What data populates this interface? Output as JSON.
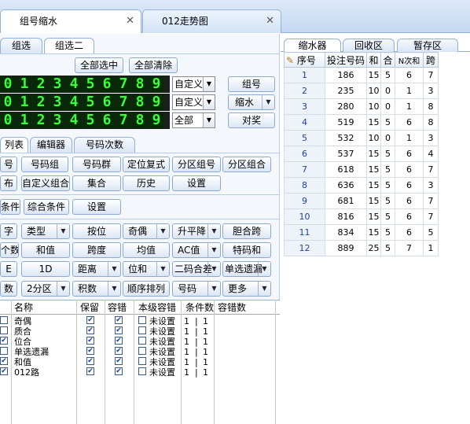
{
  "doc_tabs": [
    {
      "label": "组号缩水",
      "close": "✕"
    },
    {
      "label": "012走势图",
      "close": "✕"
    }
  ],
  "group_tabs": [
    "组选",
    "组选二"
  ],
  "actions": {
    "select_all": "全部选中",
    "clear_all": "全部清除"
  },
  "digit_rows": [
    {
      "digits": [
        "0",
        "1",
        "2",
        "3",
        "4",
        "5",
        "6",
        "7",
        "8",
        "9"
      ],
      "mode": "自定义"
    },
    {
      "digits": [
        "0",
        "1",
        "2",
        "3",
        "4",
        "5",
        "6",
        "7",
        "8",
        "9"
      ],
      "mode": "自定义"
    },
    {
      "digits": [
        "0",
        "1",
        "2",
        "3",
        "4",
        "5",
        "6",
        "7",
        "8",
        "9"
      ],
      "mode": "全部"
    }
  ],
  "side_buttons": {
    "group": "组号",
    "shrink": "缩水",
    "award": "对奖"
  },
  "tool_tabs": [
    "列表",
    "编辑器",
    "号码次数"
  ],
  "row1": [
    "号",
    "号码组",
    "号码群",
    "定位复式",
    "分区组号",
    "分区组合"
  ],
  "row2": [
    "布",
    "自定义组合",
    "集合",
    "历史",
    "设置"
  ],
  "row3": [
    "条件",
    "综合条件",
    "设置"
  ],
  "cond_row1": [
    "字",
    "类型",
    "按位",
    "奇偶",
    "升平降",
    "胆合跨"
  ],
  "cond_row2": [
    "个数",
    "和值",
    "跨度",
    "均值",
    "AC值",
    "特码和"
  ],
  "cond_row3": [
    "E",
    "1D",
    "距离",
    "位和",
    "二码合差",
    "单选遗漏"
  ],
  "cond_row4": [
    "数",
    "2分区",
    "积数",
    "顺序排列",
    "号码",
    "更多"
  ],
  "cond_table": {
    "headers": [
      "名称",
      "保留",
      "容错",
      "本级容错",
      "条件数",
      "容错数"
    ],
    "rows": [
      {
        "name": "奇偶",
        "level": "未设置",
        "cond": "1",
        "tol": "1"
      },
      {
        "name": "质合",
        "level": "未设置",
        "cond": "1",
        "tol": "1"
      },
      {
        "name": "位合",
        "level": "未设置",
        "cond": "1",
        "tol": "1"
      },
      {
        "name": "单选遗漏",
        "level": "未设置",
        "cond": "1",
        "tol": "1"
      },
      {
        "name": "和值",
        "level": "未设置",
        "cond": "1",
        "tol": "1"
      },
      {
        "name": "012路",
        "level": "未设置",
        "cond": "1",
        "tol": "1"
      }
    ]
  },
  "right_tabs": [
    "缩水器",
    "回收区",
    "暂存区"
  ],
  "result_table": {
    "headers": [
      "序号",
      "投注号码",
      "和",
      "合",
      "N次和",
      "跨"
    ],
    "rows": [
      [
        "1",
        "186",
        "15",
        "5",
        "6",
        "7"
      ],
      [
        "2",
        "235",
        "10",
        "0",
        "1",
        "3"
      ],
      [
        "3",
        "280",
        "10",
        "0",
        "1",
        "8"
      ],
      [
        "4",
        "519",
        "15",
        "5",
        "6",
        "8"
      ],
      [
        "5",
        "532",
        "10",
        "0",
        "1",
        "3"
      ],
      [
        "6",
        "537",
        "15",
        "5",
        "6",
        "4"
      ],
      [
        "7",
        "618",
        "15",
        "5",
        "6",
        "7"
      ],
      [
        "8",
        "636",
        "15",
        "5",
        "6",
        "3"
      ],
      [
        "9",
        "681",
        "15",
        "5",
        "6",
        "7"
      ],
      [
        "10",
        "816",
        "15",
        "5",
        "6",
        "7"
      ],
      [
        "11",
        "834",
        "15",
        "5",
        "6",
        "5"
      ],
      [
        "12",
        "889",
        "25",
        "5",
        "7",
        "1"
      ]
    ]
  }
}
